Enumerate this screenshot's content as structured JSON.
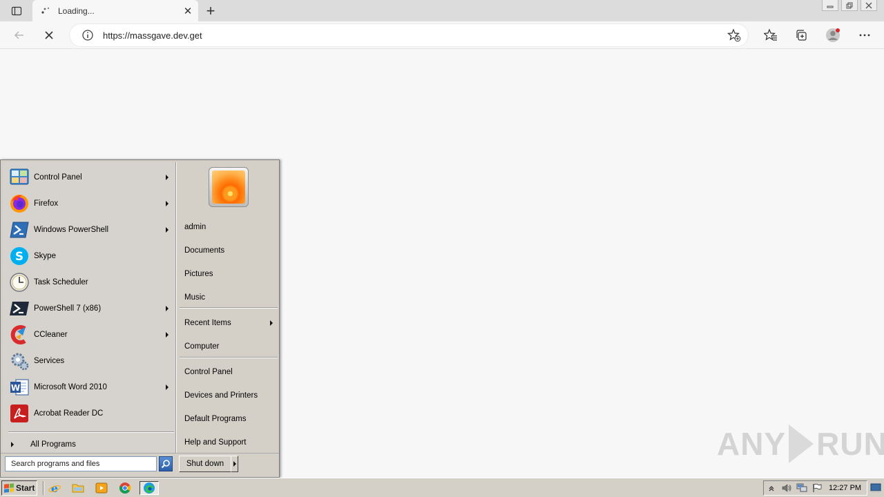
{
  "browser": {
    "tab": {
      "title": "Loading..."
    },
    "address": {
      "url": "https://massgave.dev.get"
    }
  },
  "watermark": {
    "left": "ANY",
    "right": "RUN"
  },
  "start_menu": {
    "programs": [
      {
        "label": "Control Panel",
        "icon": "control-panel-icon",
        "submenu": true
      },
      {
        "label": "Firefox",
        "icon": "firefox-icon",
        "submenu": true
      },
      {
        "label": "Windows PowerShell",
        "icon": "powershell-icon",
        "submenu": true
      },
      {
        "label": "Skype",
        "icon": "skype-icon",
        "submenu": false
      },
      {
        "label": "Task Scheduler",
        "icon": "task-scheduler-icon",
        "submenu": false
      },
      {
        "label": "PowerShell 7 (x86)",
        "icon": "powershell7-icon",
        "submenu": true
      },
      {
        "label": "CCleaner",
        "icon": "ccleaner-icon",
        "submenu": true
      },
      {
        "label": "Services",
        "icon": "services-icon",
        "submenu": false
      },
      {
        "label": "Microsoft Word 2010",
        "icon": "word-icon",
        "submenu": true
      },
      {
        "label": "Acrobat Reader DC",
        "icon": "acrobat-icon",
        "submenu": false
      }
    ],
    "all_programs": "All Programs",
    "right_links": {
      "user": "admin",
      "documents": "Documents",
      "pictures": "Pictures",
      "music": "Music",
      "recent_items": "Recent Items",
      "computer": "Computer",
      "control_panel": "Control Panel",
      "devices_printers": "Devices and Printers",
      "default_programs": "Default Programs",
      "help_support": "Help and Support"
    },
    "search_placeholder": "Search programs and files",
    "shutdown_label": "Shut down"
  },
  "taskbar": {
    "start_label": "Start",
    "clock": "12:27 PM"
  }
}
